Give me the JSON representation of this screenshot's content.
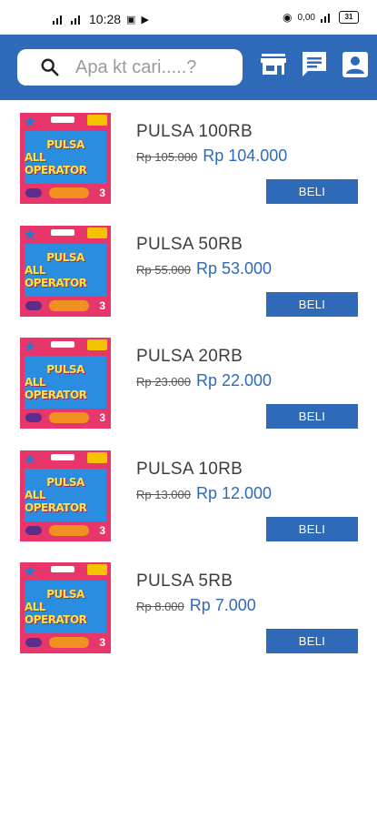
{
  "status_bar": {
    "time": "10:28",
    "net_speed": "0,00",
    "battery": "31"
  },
  "header": {
    "search_placeholder": "Apa kt cari.....?",
    "icons": [
      "search-icon",
      "store-icon",
      "chat-icon",
      "account-icon"
    ],
    "accent": "#2f6ab9"
  },
  "thumbnail": {
    "line1": "PULSA",
    "line2": "ALL OPERATOR"
  },
  "products": [
    {
      "title": "PULSA 100RB",
      "old_price": "Rp 105.000",
      "price": "Rp 104.000",
      "button": "BELI"
    },
    {
      "title": "PULSA 50RB",
      "old_price": "Rp 55.000",
      "price": "Rp 53.000",
      "button": "BELI"
    },
    {
      "title": "PULSA 20RB",
      "old_price": "Rp 23.000",
      "price": "Rp 22.000",
      "button": "BELI"
    },
    {
      "title": "PULSA 10RB",
      "old_price": "Rp 13.000",
      "price": "Rp 12.000",
      "button": "BELI"
    },
    {
      "title": "PULSA 5RB",
      "old_price": "Rp 8.000",
      "price": "Rp 7.000",
      "button": "BELI"
    }
  ]
}
